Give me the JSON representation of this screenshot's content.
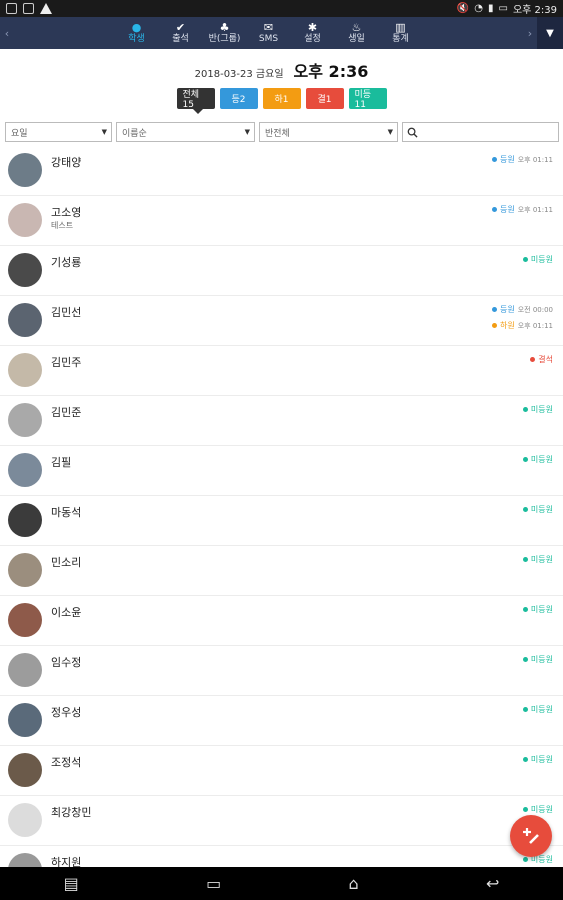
{
  "statusbar": {
    "left_icons": [
      "screen-icon",
      "notification-icon",
      "warning-icon"
    ],
    "time": "오후 2:39",
    "right_icons": [
      "mute-icon",
      "wifi-icon",
      "signal-icon",
      "battery-icon"
    ]
  },
  "nav": {
    "items": [
      {
        "label": "학생",
        "icon": "student-icon",
        "active": true
      },
      {
        "label": "출석",
        "icon": "check-icon",
        "active": false
      },
      {
        "label": "반(그룹)",
        "icon": "group-icon",
        "active": false
      },
      {
        "label": "SMS",
        "icon": "mail-icon",
        "active": false
      },
      {
        "label": "설정",
        "icon": "settings-icon",
        "active": false
      },
      {
        "label": "생일",
        "icon": "cake-icon",
        "active": false
      },
      {
        "label": "통계",
        "icon": "stats-icon",
        "active": false
      }
    ]
  },
  "header": {
    "date": "2018-03-23 금요일",
    "time": "오후 2:36"
  },
  "filters": {
    "all": "전체15",
    "b1": "등2",
    "b2": "하1",
    "b3": "결1",
    "b4": "미등11"
  },
  "selects": {
    "day": "요일",
    "sort": "이름순",
    "group": "반전체"
  },
  "students": [
    {
      "name": "강태양",
      "sub": "",
      "statuses": [
        {
          "label": "등원",
          "time": "오후 01:11",
          "color": "#3498db"
        }
      ]
    },
    {
      "name": "고소영",
      "sub": "테스트",
      "statuses": [
        {
          "label": "등원",
          "time": "오후 01:11",
          "color": "#3498db"
        }
      ]
    },
    {
      "name": "기성룡",
      "sub": "",
      "statuses": [
        {
          "label": "미등원",
          "time": "",
          "color": "#1abc9c"
        }
      ]
    },
    {
      "name": "김민선",
      "sub": "",
      "statuses": [
        {
          "label": "등원",
          "time": "오전 00:00",
          "color": "#3498db"
        },
        {
          "label": "하원",
          "time": "오후 01:11",
          "color": "#f39c12"
        }
      ]
    },
    {
      "name": "김민주",
      "sub": "",
      "statuses": [
        {
          "label": "결석",
          "time": "",
          "color": "#e74c3c"
        }
      ]
    },
    {
      "name": "김민준",
      "sub": "",
      "statuses": [
        {
          "label": "미등원",
          "time": "",
          "color": "#1abc9c"
        }
      ]
    },
    {
      "name": "김필",
      "sub": "",
      "statuses": [
        {
          "label": "미등원",
          "time": "",
          "color": "#1abc9c"
        }
      ]
    },
    {
      "name": "마동석",
      "sub": "",
      "statuses": [
        {
          "label": "미등원",
          "time": "",
          "color": "#1abc9c"
        }
      ]
    },
    {
      "name": "민소리",
      "sub": "",
      "statuses": [
        {
          "label": "미등원",
          "time": "",
          "color": "#1abc9c"
        }
      ]
    },
    {
      "name": "이소윤",
      "sub": "",
      "statuses": [
        {
          "label": "미등원",
          "time": "",
          "color": "#1abc9c"
        }
      ]
    },
    {
      "name": "임수정",
      "sub": "",
      "statuses": [
        {
          "label": "미등원",
          "time": "",
          "color": "#1abc9c"
        }
      ]
    },
    {
      "name": "정우성",
      "sub": "",
      "statuses": [
        {
          "label": "미등원",
          "time": "",
          "color": "#1abc9c"
        }
      ]
    },
    {
      "name": "조정석",
      "sub": "",
      "statuses": [
        {
          "label": "미등원",
          "time": "",
          "color": "#1abc9c"
        }
      ]
    },
    {
      "name": "최강창민",
      "sub": "",
      "statuses": [
        {
          "label": "미등원",
          "time": "",
          "color": "#1abc9c"
        }
      ]
    },
    {
      "name": "하지원",
      "sub": "",
      "statuses": [
        {
          "label": "미등원",
          "time": "",
          "color": "#1abc9c"
        }
      ]
    }
  ],
  "fab": {
    "icon": "add-edit-icon"
  },
  "bottombar": {
    "icons": [
      "recent-apps-icon",
      "screen-mirror-icon",
      "home-icon",
      "back-icon"
    ]
  }
}
